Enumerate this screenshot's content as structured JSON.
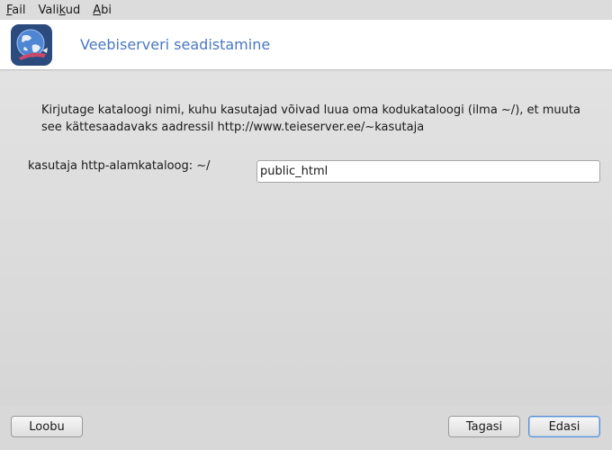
{
  "menubar": {
    "items": [
      {
        "mnemonic": "F",
        "rest": "ail"
      },
      {
        "pre": "Vali",
        "mnemonic": "k",
        "rest": "ud"
      },
      {
        "mnemonic": "A",
        "rest": "bi"
      }
    ]
  },
  "header": {
    "icon": "globe-icon",
    "title": "Veebiserveri seadistamine"
  },
  "main": {
    "description": "Kirjutage kataloogi nimi, kuhu kasutajad võivad luua oma kodukataloogi (ilma ~/), et muuta see kättesaadavaks aadressil http://www.teieserver.ee/~kasutaja",
    "field_label": "kasutaja http-alamkataloog: ~/",
    "field_value": "public_html"
  },
  "footer": {
    "cancel_label": "Loobu",
    "back_label": "Tagasi",
    "next_label": "Edasi"
  },
  "colors": {
    "title": "#4a78c2",
    "background": "#d8d8d8"
  }
}
